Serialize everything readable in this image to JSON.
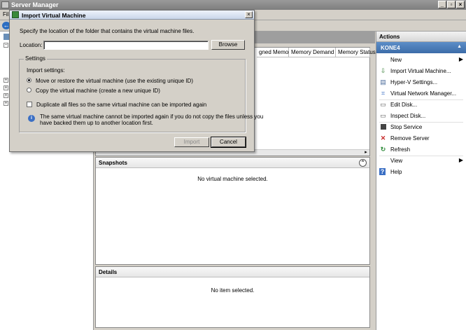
{
  "window": {
    "title": "Server Manager"
  },
  "menubar": {
    "file_label": "Fil"
  },
  "center": {
    "list_columns": [
      "gned Memory",
      "Memory Demand",
      "Memory Status"
    ],
    "snapshots_title": "Snapshots",
    "snapshots_empty": "No virtual machine selected.",
    "details_title": "Details",
    "details_empty": "No item selected."
  },
  "actions": {
    "title": "Actions",
    "group": "KONE4",
    "items": [
      {
        "label": "New",
        "icon": "blank",
        "submenu": true
      },
      {
        "label": "Import Virtual Machine...",
        "icon": "import-icon"
      },
      {
        "label": "Hyper-V Settings...",
        "icon": "settings-icon"
      },
      {
        "label": "Virtual Network Manager...",
        "icon": "network-icon"
      },
      {
        "label": "Edit Disk...",
        "icon": "edit-disk-icon"
      },
      {
        "label": "Inspect Disk...",
        "icon": "inspect-disk-icon"
      },
      {
        "label": "Stop Service",
        "icon": "stop-icon"
      },
      {
        "label": "Remove Server",
        "icon": "remove-icon"
      },
      {
        "label": "Refresh",
        "icon": "refresh-icon"
      },
      {
        "label": "View",
        "icon": "blank",
        "submenu": true
      },
      {
        "label": "Help",
        "icon": "help-icon"
      }
    ]
  },
  "dialog": {
    "title": "Import Virtual Machine",
    "instruction": "Specify the location of the folder that contains the virtual machine files.",
    "location_label": "Location:",
    "location_value": "",
    "browse_label": "Browse",
    "settings_title": "Settings",
    "import_settings_label": "Import settings:",
    "option_move": "Move or restore the virtual machine (use the existing unique ID)",
    "option_copy": "Copy the virtual machine (create a new unique ID)",
    "duplicate_label": "Duplicate all files so the same virtual machine can be imported again",
    "info_line1": "The same virtual machine cannot be imported again if you do not copy the files unless you",
    "info_line2": "have backed them up to another location first.",
    "import_label": "Import",
    "cancel_label": "Cancel"
  },
  "colors": {
    "accent": "#3c6ca8",
    "titlebar": "#8a8a8a",
    "dialog_bg": "#d4d0c8"
  }
}
